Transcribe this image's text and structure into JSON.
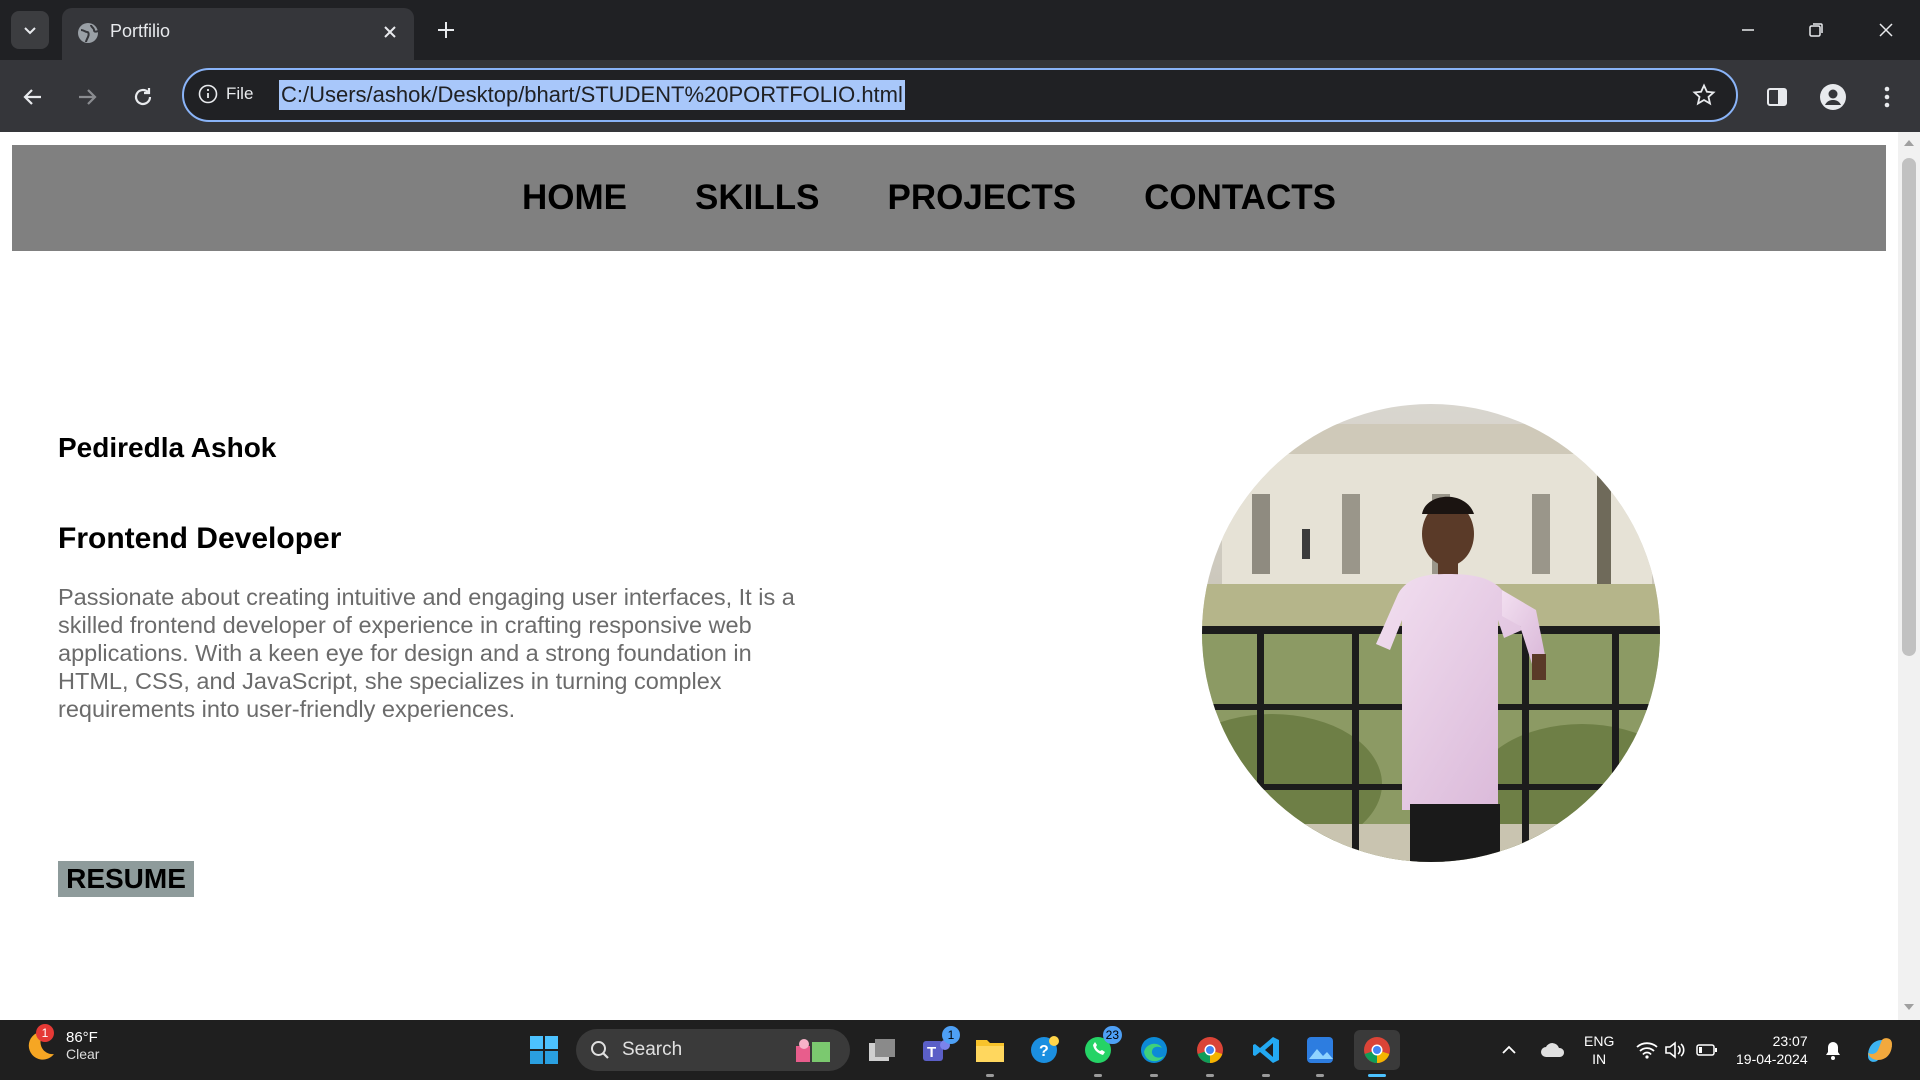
{
  "browser": {
    "tab_title": "Portfilio",
    "omnibox_scheme_label": "File",
    "url": "C:/Users/ashok/Desktop/bhart/STUDENT%20PORTFOLIO.html"
  },
  "site": {
    "nav": [
      "HOME",
      "SKILLS",
      "PROJECTS",
      "CONTACTS"
    ],
    "name": "Pediredla Ashok",
    "role": "Frontend Developer",
    "bio": "Passionate about creating intuitive and engaging user interfaces, It is a skilled frontend developer of experience in crafting responsive web applications. With a keen eye for design and a strong foundation in HTML, CSS, and JavaScript, she specializes in turning complex requirements into user-friendly experiences.",
    "resume_label": "RESUME",
    "photo_icon": "profile-photo"
  },
  "taskbar": {
    "weather_temp": "86°F",
    "weather_condition": "Clear",
    "weather_badge": "1",
    "search_label": "Search",
    "teams_badge": "1",
    "whatsapp_badge": "23",
    "lang_line1": "ENG",
    "lang_line2": "IN",
    "time": "23:07",
    "date": "19-04-2024"
  },
  "colors": {
    "nav_bg": "#808080",
    "bio_text": "#6b6b6b",
    "resume_bg": "#8e9b9b",
    "url_highlight": "#a8c7fa"
  }
}
